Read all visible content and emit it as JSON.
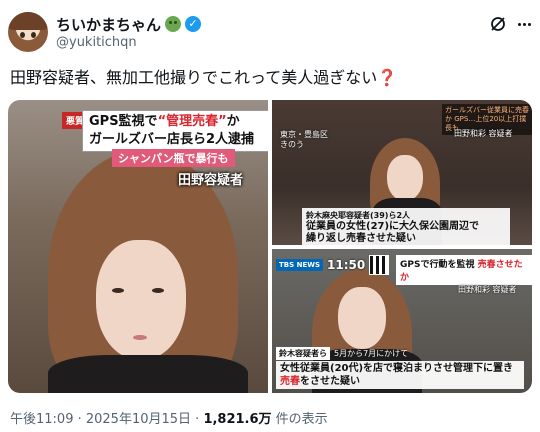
{
  "author": {
    "display_name": "ちいかまちゃん",
    "handle": "@yukitichqn",
    "avatar_icon": "anime-girl-avatar",
    "emoji_icon": "nauseated-face-emoji",
    "verified_icon": "verified-badge-icon"
  },
  "tweet": {
    "text": "田野容疑者、無加工他撮りでこれって美人過ぎない",
    "emoji": "❓"
  },
  "media": {
    "main": {
      "tag": "悪質",
      "caption_line1_prefix": "GPS監視で",
      "caption_line1_red": "“管理売春”",
      "caption_line1_suffix": "か",
      "caption_line2": "ガールズバー店長ら2人逮捕",
      "pink_banner": "シャンパン瓶で暴行も",
      "name_label": "田野容疑者"
    },
    "top_right": {
      "ticker": "ガールズバー従業員に売春か GPS…上位20以上打撲長も",
      "location_line1": "東京・豊島区",
      "location_line2": "きのう",
      "name": "田野和彩 容疑者",
      "caption_line1": "鈴木麻央耶容疑者(39)ら2人",
      "caption_line2": "従業員の女性(27)に大久保公園周辺で",
      "caption_line3": "繰り返し売春させた疑い"
    },
    "bottom_right": {
      "channel": "TBS NEWS",
      "time": "11:50",
      "gps_prefix": "GPSで行動を監視",
      "gps_red": "売春させたか",
      "name": "田野和彩 容疑者",
      "who": "鈴木容疑者ら",
      "when": "5月から7月にかけて",
      "body_line1": "女性従業員(20代)を店で寝泊まりさせ管理下に置き",
      "body_line2_red": "売春",
      "body_line2_suffix": "をさせた疑い"
    }
  },
  "meta": {
    "timestamp": "午後11:09 · 2025年10月15日 · ",
    "views": "1,821.6万",
    "views_suffix": " 件の表示"
  }
}
